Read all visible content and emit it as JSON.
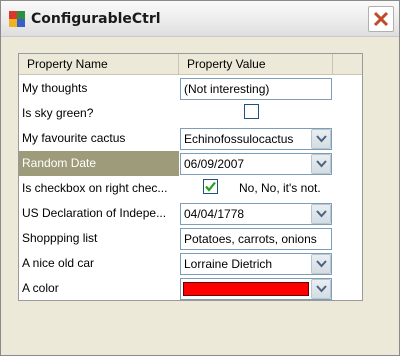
{
  "window": {
    "title": "ConfigurableCtrl"
  },
  "grid": {
    "header_name": "Property Name",
    "header_value": "Property Value",
    "rows": [
      {
        "name": "My thoughts",
        "value": "(Not interesting)"
      },
      {
        "name": "Is sky green?",
        "checked": false
      },
      {
        "name": "My favourite cactus",
        "value": "Echinofossulocactus"
      },
      {
        "name": "Random Date",
        "value": "06/09/2007"
      },
      {
        "name": "Is checkbox on right chec...",
        "value": "No, No, it's not.",
        "checked": true
      },
      {
        "name": "US Declaration of Indepe...",
        "value": "04/04/1778"
      },
      {
        "name": "Shoppping list",
        "value": "Potatoes, carrots, onions"
      },
      {
        "name": "A nice old car",
        "value": "Lorraine Dietrich"
      },
      {
        "name": "A color",
        "value": "#ff0000"
      }
    ]
  },
  "colors": {
    "selected_row": "#9e9b7a",
    "combo_border": "#7f9db9",
    "color_value": "#ff0000"
  }
}
